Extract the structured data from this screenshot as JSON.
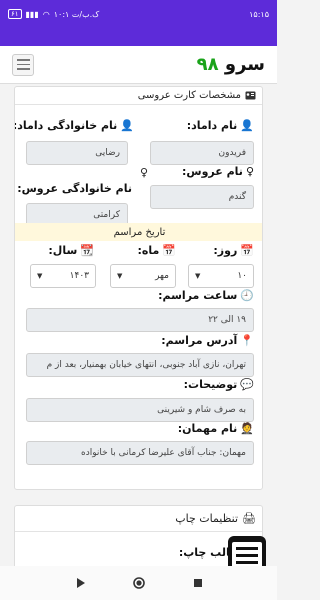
{
  "status": {
    "time": "۱۵:۱۵",
    "time_left": "۱۰:۱ ک.ب/ت",
    "battery": "۶۱"
  },
  "app": {
    "logo_text": "سرو",
    "logo_num": "۹۸"
  },
  "card": {
    "title": "مشخصات کارت عروسی",
    "groom_name_label": "نام داماد:",
    "groom_name_value": "فریدون",
    "groom_family_label": "نام خانوادگی داماد:",
    "groom_family_value": "رضایی",
    "bride_name_label": "نام عروس:",
    "bride_name_value": "گندم",
    "bride_family_label": "نام خانوادگی عروس:",
    "bride_family_value": "کرامتی",
    "ceremony_date_band": "تاریخ مراسم",
    "day_label": "روز:",
    "day_value": "۱۰",
    "month_label": "ماه:",
    "month_value": "مهر",
    "year_label": "سال:",
    "year_value": "۱۴۰۳",
    "time_label": "ساعت مراسم:",
    "time_value": "۱۹ الی ۲۲",
    "address_label": "آدرس مراسم:",
    "address_value": "تهران، نازی آباد جنوبی، انتهای خیابان بهمنیار، بعد از م",
    "desc_label": "توضیحات:",
    "desc_value": "به صرف شام و شیرینی",
    "guest_label": "نام مهمان:",
    "guest_value": "مهمان: جناب آقای علیرضا کرمانی با خانواده"
  },
  "print": {
    "title": "تنظیمات چاپ",
    "template_label": "قالب چاپ:"
  },
  "colors": {
    "statusbar": "#5d2bd9",
    "logo_number": "#1aa31a"
  }
}
